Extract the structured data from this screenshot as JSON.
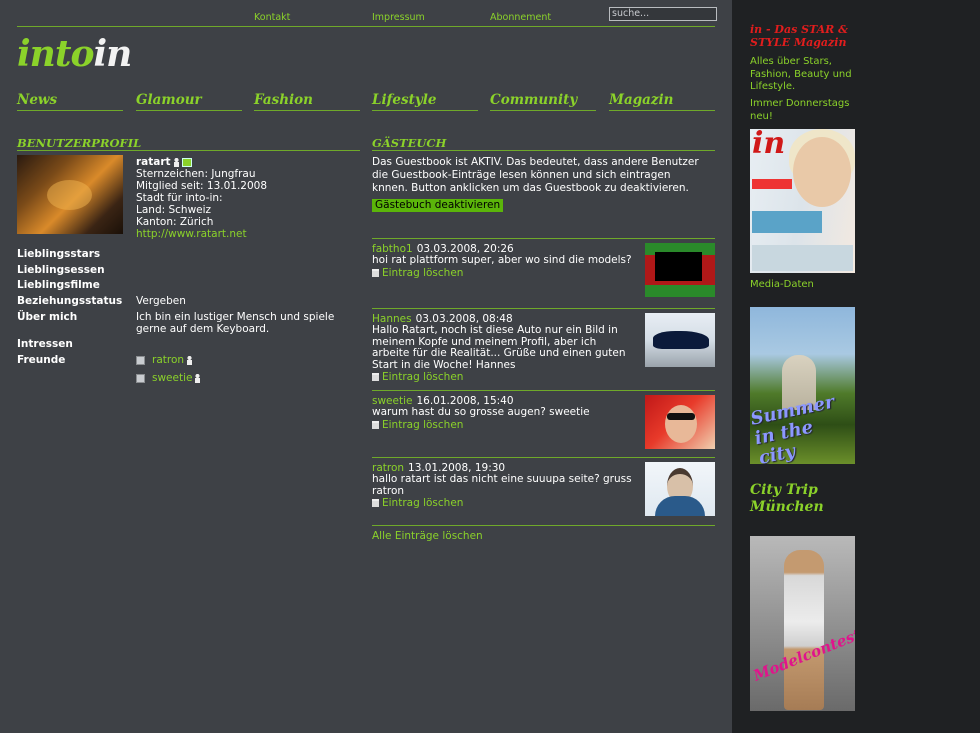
{
  "top_links": [
    "Kontakt",
    "Impressum",
    "Abonnement"
  ],
  "search": {
    "placeholder": "suche..."
  },
  "logo": {
    "into": "into",
    "in": "in"
  },
  "nav": [
    "News",
    "Glamour",
    "Fashion",
    "Lifestyle",
    "Community",
    "Magazin"
  ],
  "profile": {
    "heading": "BENUTZERPROFIL",
    "username": "ratart",
    "sign": "Sternzeichen: Jungfrau",
    "member_since": "Mitglied seit: 13.01.2008",
    "city": "Stadt für into-in:",
    "country": "Land: Schweiz",
    "canton": "Kanton: Zürich",
    "website": "http://www.ratart.net",
    "labels": {
      "stars": "Lieblingsstars",
      "food": "Lieblingsessen",
      "films": "Lieblingsfilme",
      "relationship": "Beziehungsstatus",
      "about": "Über mich",
      "interests": "Intressen",
      "friends": "Freunde"
    },
    "relationship_value": "Vergeben",
    "about_value": "Ich bin ein lustiger Mensch und spiele gerne auf dem Keyboard.",
    "friends": [
      "ratron",
      "sweetie"
    ]
  },
  "guestbook": {
    "heading": "GÄSTEUCH",
    "intro": "Das Guestbook ist AKTIV. Das bedeutet, dass andere Benutzer die Guestbook-Einträge lesen können und sich eintragen knnen. Button anklicken um das Guestbook zu deaktivieren.",
    "deactivate_label": "Gästebuch deaktivieren",
    "delete_label": "Eintrag löschen",
    "delete_all_label": "Alle Einträge löschen",
    "entries": [
      {
        "user": "fabtho1",
        "date": "03.03.2008, 20:26",
        "text": "hoi rat plattform super, aber wo sind die models?"
      },
      {
        "user": "Hannes",
        "date": "03.03.2008, 08:48",
        "text": "Hallo Ratart, noch ist diese Auto nur ein Bild in meinem Kopfe und meinem Profil, aber ich arbeite für die Realität... Grüße und einen guten Start in die Woche! Hannes"
      },
      {
        "user": "sweetie",
        "date": "16.01.2008, 15:40",
        "text": "warum hast du so grosse augen? sweetie"
      },
      {
        "user": "ratron",
        "date": "13.01.2008, 19:30",
        "text": "hallo ratart ist das nicht eine suuupa seite? gruss ratron"
      }
    ]
  },
  "sidebar": {
    "title": "in - Das STAR & STYLE Magazin",
    "desc": "Alles über Stars, Fashion, Beauty und Lifestyle.",
    "thursday": "Immer Donnerstags neu!",
    "cover_logo": "in",
    "media_label": "Media-Daten",
    "summer_text": "Summer in the city",
    "city_trip": "City Trip München",
    "model_text": "Modelcontest"
  },
  "colors": {
    "accent": "#8bd22a",
    "background": "#3e4146",
    "sidebar": "#1f2123",
    "brand_red": "#e11d1d"
  }
}
